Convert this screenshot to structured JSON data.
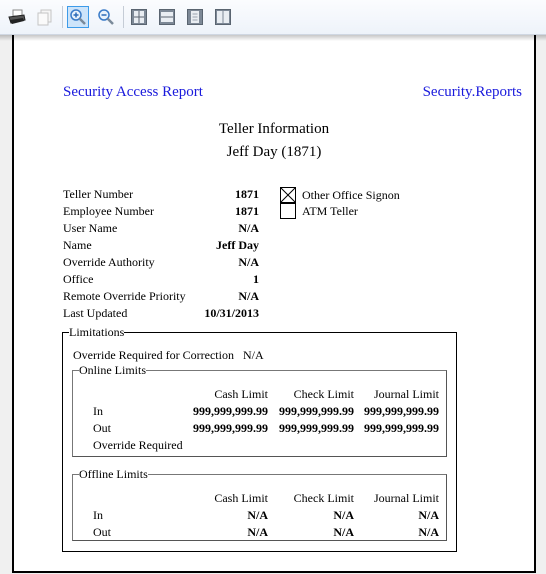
{
  "toolbar": {
    "buttons": [
      {
        "name": "print",
        "icon": "printer-icon",
        "active": false
      },
      {
        "name": "copy",
        "icon": "copy-icon",
        "active": false,
        "disabled": true
      },
      {
        "name": "zoom-in",
        "icon": "zoom-in-icon",
        "active": true
      },
      {
        "name": "zoom-out",
        "icon": "zoom-out-icon",
        "active": false
      },
      {
        "name": "fit-page",
        "icon": "fit-page-icon",
        "active": false
      },
      {
        "name": "fit-width",
        "icon": "fit-width-icon",
        "active": false
      },
      {
        "name": "single-page",
        "icon": "single-page-icon",
        "active": false
      },
      {
        "name": "two-pages",
        "icon": "two-pages-icon",
        "active": false
      }
    ]
  },
  "report": {
    "header_left": "Security Access Report",
    "header_right": "Security.Reports",
    "title": "Teller Information",
    "subtitle": "Jeff Day (1871)",
    "link_color": "#1a1adc"
  },
  "info": [
    {
      "label": "Teller Number",
      "value": "1871"
    },
    {
      "label": "Employee Number",
      "value": "1871"
    },
    {
      "label": "User Name",
      "value": "N/A"
    },
    {
      "label": "Name",
      "value": "Jeff Day"
    },
    {
      "label": "Override Authority",
      "value": "N/A"
    },
    {
      "label": "Office",
      "value": "1"
    },
    {
      "label": "Remote Override Priority",
      "value": "N/A"
    },
    {
      "label": "Last Updated",
      "value": "10/31/2013"
    }
  ],
  "checks": [
    {
      "label": "Other Office Signon",
      "checked": true
    },
    {
      "label": "ATM Teller",
      "checked": false
    }
  ],
  "limitations": {
    "legend": "Limitations",
    "override_correction_label": "Override Required for Correction",
    "override_correction_value": "N/A",
    "online": {
      "legend": "Online Limits",
      "columns": [
        "Cash Limit",
        "Check Limit",
        "Journal Limit"
      ],
      "rows": [
        {
          "label": "In",
          "values": [
            "999,999,999.99",
            "999,999,999.99",
            "999,999,999.99"
          ]
        },
        {
          "label": "Out",
          "values": [
            "999,999,999.99",
            "999,999,999.99",
            "999,999,999.99"
          ]
        },
        {
          "label": "Override Required",
          "values": [
            "",
            "",
            ""
          ]
        }
      ]
    },
    "offline": {
      "legend": "Offline Limits",
      "columns": [
        "Cash Limit",
        "Check Limit",
        "Journal Limit"
      ],
      "rows": [
        {
          "label": "In",
          "values": [
            "N/A",
            "N/A",
            "N/A"
          ]
        },
        {
          "label": "Out",
          "values": [
            "N/A",
            "N/A",
            "N/A"
          ]
        }
      ]
    }
  }
}
